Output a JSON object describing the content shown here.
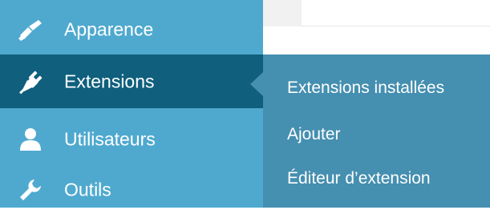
{
  "menu": {
    "items": [
      {
        "label": "Apparence",
        "icon": "brush-icon",
        "current": false
      },
      {
        "label": "Extensions",
        "icon": "plug-icon",
        "current": true
      },
      {
        "label": "Utilisateurs",
        "icon": "user-icon",
        "current": false
      },
      {
        "label": "Outils",
        "icon": "wrench-icon",
        "current": false
      }
    ]
  },
  "submenu": {
    "items": [
      {
        "label": "Extensions installées"
      },
      {
        "label": "Ajouter"
      },
      {
        "label": "Éditeur d’extension"
      }
    ]
  },
  "colors": {
    "sidebar": "#4fa9cf",
    "current_item": "#0f5f7d",
    "submenu": "#458fb0",
    "text": "#ffffff"
  }
}
